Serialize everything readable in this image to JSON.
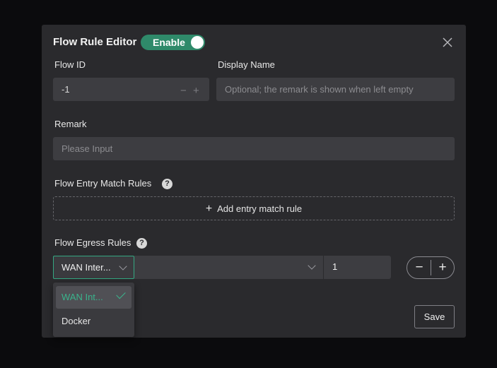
{
  "dialog": {
    "title": "Flow Rule Editor",
    "enable_label": "Enable",
    "enabled": true
  },
  "flow_id": {
    "label": "Flow ID",
    "value": "-1",
    "minus": "−",
    "plus": "+"
  },
  "display_name": {
    "label": "Display Name",
    "placeholder": "Optional; the remark is shown when left empty"
  },
  "remark": {
    "label": "Remark",
    "placeholder": "Please Input"
  },
  "entry_rules": {
    "label": "Flow Entry Match Rules",
    "help": "?",
    "add_label": "Add entry match rule",
    "add_icon": "+"
  },
  "egress_rules": {
    "label": "Flow Egress Rules",
    "help": "?",
    "interface_value": "WAN Inter...",
    "second_value": "",
    "number_value": "1",
    "minus": "−",
    "plus": "+"
  },
  "dropdown": {
    "options": [
      {
        "label": "WAN Int...",
        "selected": true
      },
      {
        "label": "Docker",
        "selected": false
      }
    ]
  },
  "save_label": "Save",
  "colors": {
    "accent": "#2f8a6a",
    "check": "#3ab38c",
    "dialog_bg": "#2a2a2d",
    "input_bg": "#3d3d41"
  }
}
